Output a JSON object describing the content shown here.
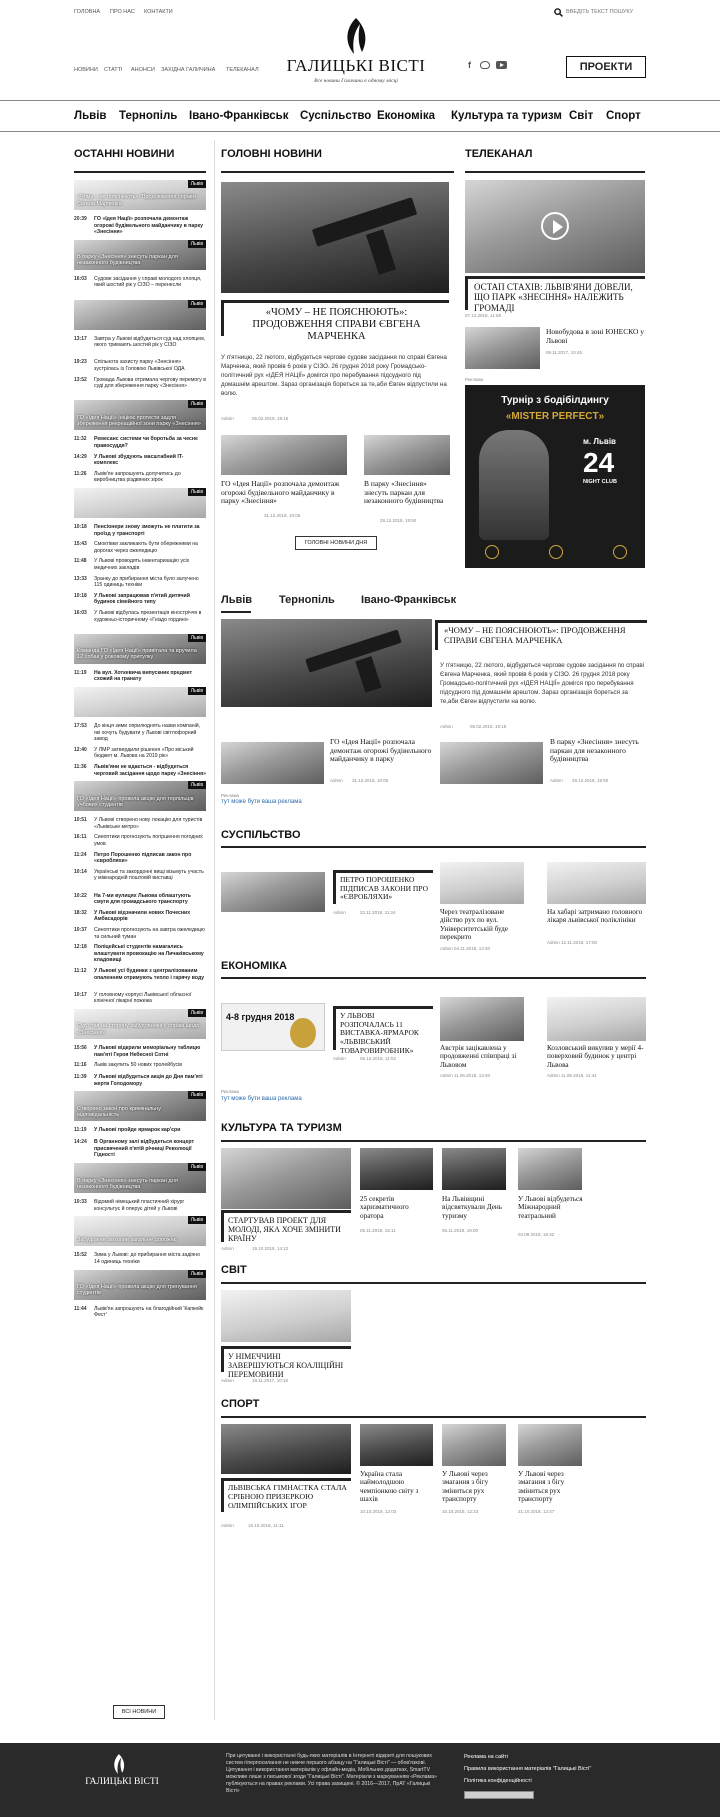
{
  "topbar": {
    "links": [
      "ГОЛОВНА",
      "ПРО НАС",
      "КОНТАКТИ"
    ],
    "search_placeholder": "ВВЕДІТЬ ТЕКСТ ПОШУКУ"
  },
  "subnav": [
    "НОВИНИ",
    "СТАТТІ",
    "АНОНСИ",
    "ЗАХІДНА ГАЛИЧИНА",
    "ТЕЛЕКАНАЛ"
  ],
  "logo": {
    "title": "ГАЛИЦЬКІ ВІСТІ",
    "tagline": "Все новини Галичини в одному місці"
  },
  "projects_button": "ПРОЕКТИ",
  "main_nav": [
    "Львів",
    "Тернопіль",
    "Івано-Франківськ",
    "Суспільство",
    "Економіка",
    "Культура та туризм",
    "Світ",
    "Спорт"
  ],
  "latest": {
    "title": "ОСТАННІ НОВИНИ",
    "more": "ВСІ НОВИНИ",
    "items": [
      {
        "type": "photo",
        "caption": "«Чому – не пояснюють»: Продовження справи Євгена Марченка"
      },
      {
        "type": "text",
        "time": "20:39",
        "text": "ГО «Ідея Нації» розпочала демонтаж огорожі будівельного майданчику в парку «Знесіння»",
        "bold": true
      },
      {
        "type": "photo",
        "caption": "В парку «Знесіння» знесуть паркан для незаконного будівництва"
      },
      {
        "type": "text",
        "time": "16:03",
        "text": "Судове засідання у справі молодого хлопця, який шостий рік у СІЗО – перенесли",
        "bold": false
      },
      {
        "type": "photo",
        "caption": ""
      },
      {
        "type": "text",
        "time": "13:17",
        "text": "Завтра у Львові відбудеться суд над хлопцем, якого тримають шостий рік у СІЗО",
        "bold": false
      },
      {
        "type": "text",
        "time": "19:23",
        "text": "Спільнота захисту парку «Знесіння» зустрілась із Головою Львівської ОДА",
        "bold": false
      },
      {
        "type": "text",
        "time": "13:52",
        "text": "Громада Львова отримала чергову перемогу в суді для збереження парку «Знесіння»",
        "bold": false
      },
      {
        "type": "photo",
        "caption": "ГО «Ідея Нації» ініціює протести задля збереження рекреаційної зони парку «Знесіння»"
      },
      {
        "type": "text",
        "time": "11:32",
        "text": "Ремесанс системи чи боротьба за чесне правосуддя?",
        "bold": true
      },
      {
        "type": "text",
        "time": "14:29",
        "text": "У Львові збудують масштабний IT-комплекс",
        "bold": true
      },
      {
        "type": "text",
        "time": "11:26",
        "text": "Львів'ян запрошують долучитись до виробництва різдвяних зірок",
        "bold": false
      },
      {
        "type": "photo",
        "caption": ""
      },
      {
        "type": "text",
        "time": "10:18",
        "text": "Пенсіонери знову зможуть не платити за проїзд у транспорті",
        "bold": true
      },
      {
        "type": "text",
        "time": "15:43",
        "text": "Смоктівки закликають бути обережними на дорогах через ожеледицю",
        "bold": false
      },
      {
        "type": "text",
        "time": "11:48",
        "text": "У Львові проводять інвентаризацію усіх медичних закладів",
        "bold": false
      },
      {
        "type": "text",
        "time": "13:33",
        "text": "Зранку до прибирання міста було залучено 115 одиниць техніки",
        "bold": false
      },
      {
        "type": "text",
        "time": "10:18",
        "text": "У Львові запрацював п'ятий дитячий будинок сімейного типу",
        "bold": true
      },
      {
        "type": "text",
        "time": "16:03",
        "text": "У Львові відбулась презентація кіностріччя в художньо-історичному «Гніздо гордині»",
        "bold": false
      },
      {
        "type": "photo",
        "caption": "Команда ГО «Ідея Нації» привітала та вручила 12 собак у роковому притулку"
      },
      {
        "type": "text",
        "time": "11:19",
        "text": "На вул. Хоткевича випускник предмет схожий на гранату",
        "bold": true
      },
      {
        "type": "photo",
        "caption": ""
      },
      {
        "type": "text",
        "time": "17:53",
        "text": "До кінця зими оприлюднять назви компаній, які хочуть будувати у Львові світлофорний завод",
        "bold": false
      },
      {
        "type": "text",
        "time": "12:40",
        "text": "У ЛМР затвердили рішення «Про міський бюджет м. Львова на 2019 рік»",
        "bold": false
      },
      {
        "type": "text",
        "time": "11:36",
        "text": "Львів'яни не вдається - відбудеться черговий засідання щодо парку «Знесіння»",
        "bold": true
      },
      {
        "type": "photo",
        "caption": "ГО «Ідея Нації» провела акцію для терпільців учбових студентів"
      },
      {
        "type": "text",
        "time": "10:51",
        "text": "У Львові створено нову локацію для туристів «Львівське метро»",
        "bold": false
      },
      {
        "type": "text",
        "time": "16:11",
        "text": "Синоптики прогнозують погіршення погодних умов",
        "bold": false
      },
      {
        "type": "text",
        "time": "11:24",
        "text": "Петро Порошенко підписав закон про «євробляхи»",
        "bold": true
      },
      {
        "type": "text",
        "time": "10:14",
        "text": "Українські та закордонні вищі візьмуть участь у міжнародній поштовій виставці",
        "bold": false
      },
      {
        "type": "text",
        "time": "10:22",
        "text": "На 7-ми вулицях Львова облаштують смуги для громадського транспорту",
        "bold": true
      },
      {
        "type": "text",
        "time": "18:32",
        "text": "У Львові відзначили нових Почесних Амбасадорів",
        "bold": true
      },
      {
        "type": "text",
        "time": "10:37",
        "text": "Синоптики прогнозують на завтра ожеледицю та сильний туман",
        "bold": false
      },
      {
        "type": "text",
        "time": "12:18",
        "text": "Поліцейські студентів намагались влаштувати провокацію на Личаківському кладовищі",
        "bold": true
      },
      {
        "type": "text",
        "time": "11:12",
        "text": "У Львові усі будинки з централізованим опаленням отримують тепло і гарячу воду",
        "bold": true
      },
      {
        "type": "text",
        "time": "10:17",
        "text": "У головному корпусі Львівської обласної клінічної лікарні пожежа",
        "bold": false
      },
      {
        "type": "photo",
        "caption": "Суд став на сторону забудовника у справі щодо «Знесіння»"
      },
      {
        "type": "text",
        "time": "15:56",
        "text": "У Львові відкрили меморіальну таблицю пам'яті Героя Небесної Сотні",
        "bold": true
      },
      {
        "type": "text",
        "time": "11:16",
        "text": "Львів закупить 50 нових тролейбусів",
        "bold": false
      },
      {
        "type": "text",
        "time": "11:39",
        "text": "У Львові відбудеться акція до Дня пам'яті жертв Голодомору",
        "bold": true
      },
      {
        "type": "photo",
        "caption": "Створено закон про кримінальну відповідальність"
      },
      {
        "type": "text",
        "time": "11:19",
        "text": "У Львові пройде ярмарок кар'єри",
        "bold": true
      },
      {
        "type": "text",
        "time": "14:24",
        "text": "В Органному залі відбудеться концерт присвячений п'ятій річниці Революції Гідності",
        "bold": true
      },
      {
        "type": "photo",
        "caption": "В парку «Знесіння» знесуть паркан для незаконного будівництва"
      },
      {
        "type": "text",
        "time": "10:33",
        "text": "Відомий німецький пластичний хірург консультує й оперує дітей у Львові",
        "bold": false
      },
      {
        "type": "photo",
        "caption": "Забудовник вихопив загальне дорожнє"
      },
      {
        "type": "text",
        "time": "15:52",
        "text": "Зима у Львові: до прибирання міста задіяно 14 одиниць техніки",
        "bold": false
      },
      {
        "type": "photo",
        "caption": "ГО «Ідея Нації» провела акцію для тренування студентів"
      },
      {
        "type": "text",
        "time": "11:44",
        "text": "Львів'ян запрошують на благодійний 'Капкейк Фест'",
        "bold": false
      }
    ]
  },
  "main_news": {
    "title": "ГОЛОВНІ НОВИНИ",
    "lead": {
      "headline": "«ЧОМУ – НЕ ПОЯСНЮЮТЬ»: ПРОДОВЖЕННЯ СПРАВИ ЄВГЕНА МАРЧЕНКА",
      "text": "У п'ятницю, 22 лютого, відбудеться чергове судове засідання по справі Євгена Марченка, який провів 6 років у СІЗО. 26 грудня 2018 року Громадсько-політичний рух «ІДЕЯ НАЦІЇ» домігся про перебування підсудного під домашнім арештом. Зараз організація бореться за те,аби Євген відпустили на волю.",
      "author": "Admin",
      "date": "05.02.2019, 19:15"
    },
    "small": [
      {
        "headline": "ГО «Ідея Нації» розпочала демонтаж огорожі будівельного майданчику в парку «Знесіння»",
        "date": "31.12.2018, 10:05"
      },
      {
        "headline": "В парку «Знесіння» знесуть паркан для незаконного будівництва",
        "date": "29.12.2018, 19:50"
      }
    ],
    "more": "ГОЛОВНІ НОВИНИ ДНЯ"
  },
  "tv": {
    "title": "ТЕЛЕКАНАЛ",
    "video": {
      "headline": "ОСТАП СТАХІВ: ЛЬВІВ'ЯНИ ДОВЕЛИ, ЩО ПАРК «ЗНЕСІННЯ» НАЛЕЖИТЬ ГРОМАДІ",
      "date": "07.12.2018, 11:58"
    },
    "small": {
      "headline": "Новобудова в зоні ЮНЕСКО у Львові",
      "date": "08.11.2017, 10:45"
    },
    "ad_label": "Реклама",
    "ad": {
      "title": "Турнір з бодібілдингу",
      "sub": "«MISTER PERFECT»",
      "city": "м. Львів",
      "day": "24",
      "club": "NIGHT CLUB"
    }
  },
  "regions": {
    "tabs": [
      "Львів",
      "Тернопіль",
      "Івано-Франківськ"
    ],
    "lead": {
      "headline": "«ЧОМУ – НЕ ПОЯСНЮЮТЬ»: ПРОДОВЖЕННЯ СПРАВИ ЄВГЕНА МАРЧЕНКА",
      "text": "У п'ятницю, 22 лютого, відбудеться чергове судове засідання по справі Євгена Марченка, який провів 6 років у СІЗО. 26 грудня 2018 року Громадсько-політичний рух «ІДЕЯ НАЦІЇ» домігся про перебування підсудного під домашнім арештом. Зараз організація бореться за те,аби Євген відпустили на волю.",
      "author": "Admin",
      "date": "05.02.2019, 19:15"
    },
    "small": [
      {
        "headline": "ГО «Ідея Нації» розпочала демонтаж огорожі будівельного майданчику в парку",
        "author": "Admin",
        "date": "31.12.2018, 10:05"
      },
      {
        "headline": "В парку «Знесіння» знесуть паркан для незаконного будівництва",
        "author": "Admin",
        "date": "29.12.2018, 19:50"
      }
    ],
    "ad_label": "Реклама",
    "ad_link": "тут може бути ваша реклама"
  },
  "society": {
    "title": "СУСПІЛЬСТВО",
    "lead": {
      "headline": "ПЕТРО ПОРОШЕНКО ПІДПИСАВ ЗАКОНИ ПРО «ЄВРОБЛЯХИ»",
      "author": "Admin",
      "date": "22.11.2018, 11:24"
    },
    "items": [
      {
        "headline": "Через театралізоване дійство рух по вул. Університетській буде перекрито",
        "date": "Admin 04.11.2018, 13:40"
      },
      {
        "headline": "На хабарі затримано головного лікаря львівської поліклініки",
        "date": "Admin 12.11.2018, 17:00"
      }
    ]
  },
  "economy": {
    "title": "ЕКОНОМІКА",
    "lead": {
      "headline": "У ЛЬВОВІ РОЗПОЧАЛАСЬ 11 ВИСТАВКА-ЯРМАРОК «ЛЬВІВСЬКИЙ ТОВАРОВИРОБНИК»",
      "author": "Admin",
      "date": "06.12.2018, 11:52",
      "banner_date": "4-8 грудня 2018"
    },
    "items": [
      {
        "headline": "Австрія зацікавлена у продовженні співпраці зі Львовом",
        "date": "Admin 11.06.2018, 13:40"
      },
      {
        "headline": "Козловський викупив у мерії 4-поверховий будинок у центрі Львова",
        "date": "Admin 11.06.2018, 11:44"
      }
    ],
    "ad_label": "Реклама",
    "ad_link": "тут може бути ваша реклама"
  },
  "culture": {
    "title": "КУЛЬТУРА ТА ТУРИЗМ",
    "lead": {
      "headline": "СТАРТУВАВ ПРОЕКТ ДЛЯ МОЛОДІ, ЯКА ХОЧЕ ЗМІНИТИ КРАЇНУ",
      "author": "Admin",
      "date": "19.10.2018, 14:12"
    },
    "items": [
      {
        "headline": "25 секретів харизматичного оратора",
        "date": "05.11.2018, 15:11"
      },
      {
        "headline": "На Львівщині відсвяткували День туризму",
        "date": "05.11.2018, 19:00"
      },
      {
        "headline": "У Львові відбудеться Міжнародний театральний",
        "date": "04.09.2018, 15:32"
      }
    ]
  },
  "world": {
    "title": "СВІТ",
    "lead": {
      "headline": "У НІМЕЧЧИНІ ЗАВЕРШУЮТЬСЯ КОАЛІЦІЙНІ ПЕРЕМОВИНИ",
      "author": "Admin",
      "date": "18.11.2017, 10:16"
    }
  },
  "sport": {
    "title": "СПОРТ",
    "lead": {
      "headline": "ЛЬВІВСЬКА ГІМНАСТКА СТАЛА СРІБНОЮ ПРИЗЕРКОЮ ОЛІМПІЙСЬКИХ ІГОР",
      "author": "Admin",
      "date": "15.10.2018, 11:11"
    },
    "items": [
      {
        "headline": "Україна стала наймолодшою чемпіонкою світу з шахів",
        "date": "10.10.2018, 12:03"
      },
      {
        "headline": "У Львові через змагання з бігу зміниться рух транспорту",
        "date": "10.10.2018, 12:23"
      },
      {
        "headline": "У Львові через змагання з бігу зміниться рух транспорту",
        "date": "21.10.2018, 13:47"
      }
    ]
  },
  "footer": {
    "logo": "ГАЛИЦЬКІ ВІСТІ",
    "text": "При цитуванні і використанні будь-яких матеріалів в Інтернеті відкриті для пошукових систем гіперпосилання не нижче першого абзацу на \"Галицькі Вісті\" — обов'язкові. Цитування і використання матеріалів у офлайн-медіа, Мобільних додатках, SmartTV можливе лише з письмової згоди \"Галицькі Вісті\". Матеріали з маркуванням «Реклама» публікуються на правах реклами. Усі права захищені. © 2016—2017, ПрАТ «Галицькі Вісті»",
    "links": [
      "Реклама на сайті",
      "Правила використання матеріалів \"Галицькі Вісті\"",
      "Політика конфіденційності"
    ]
  },
  "colors": {
    "accent": "#111111",
    "link": "#2b6cb0",
    "footer_bg": "#2a2a2a"
  }
}
